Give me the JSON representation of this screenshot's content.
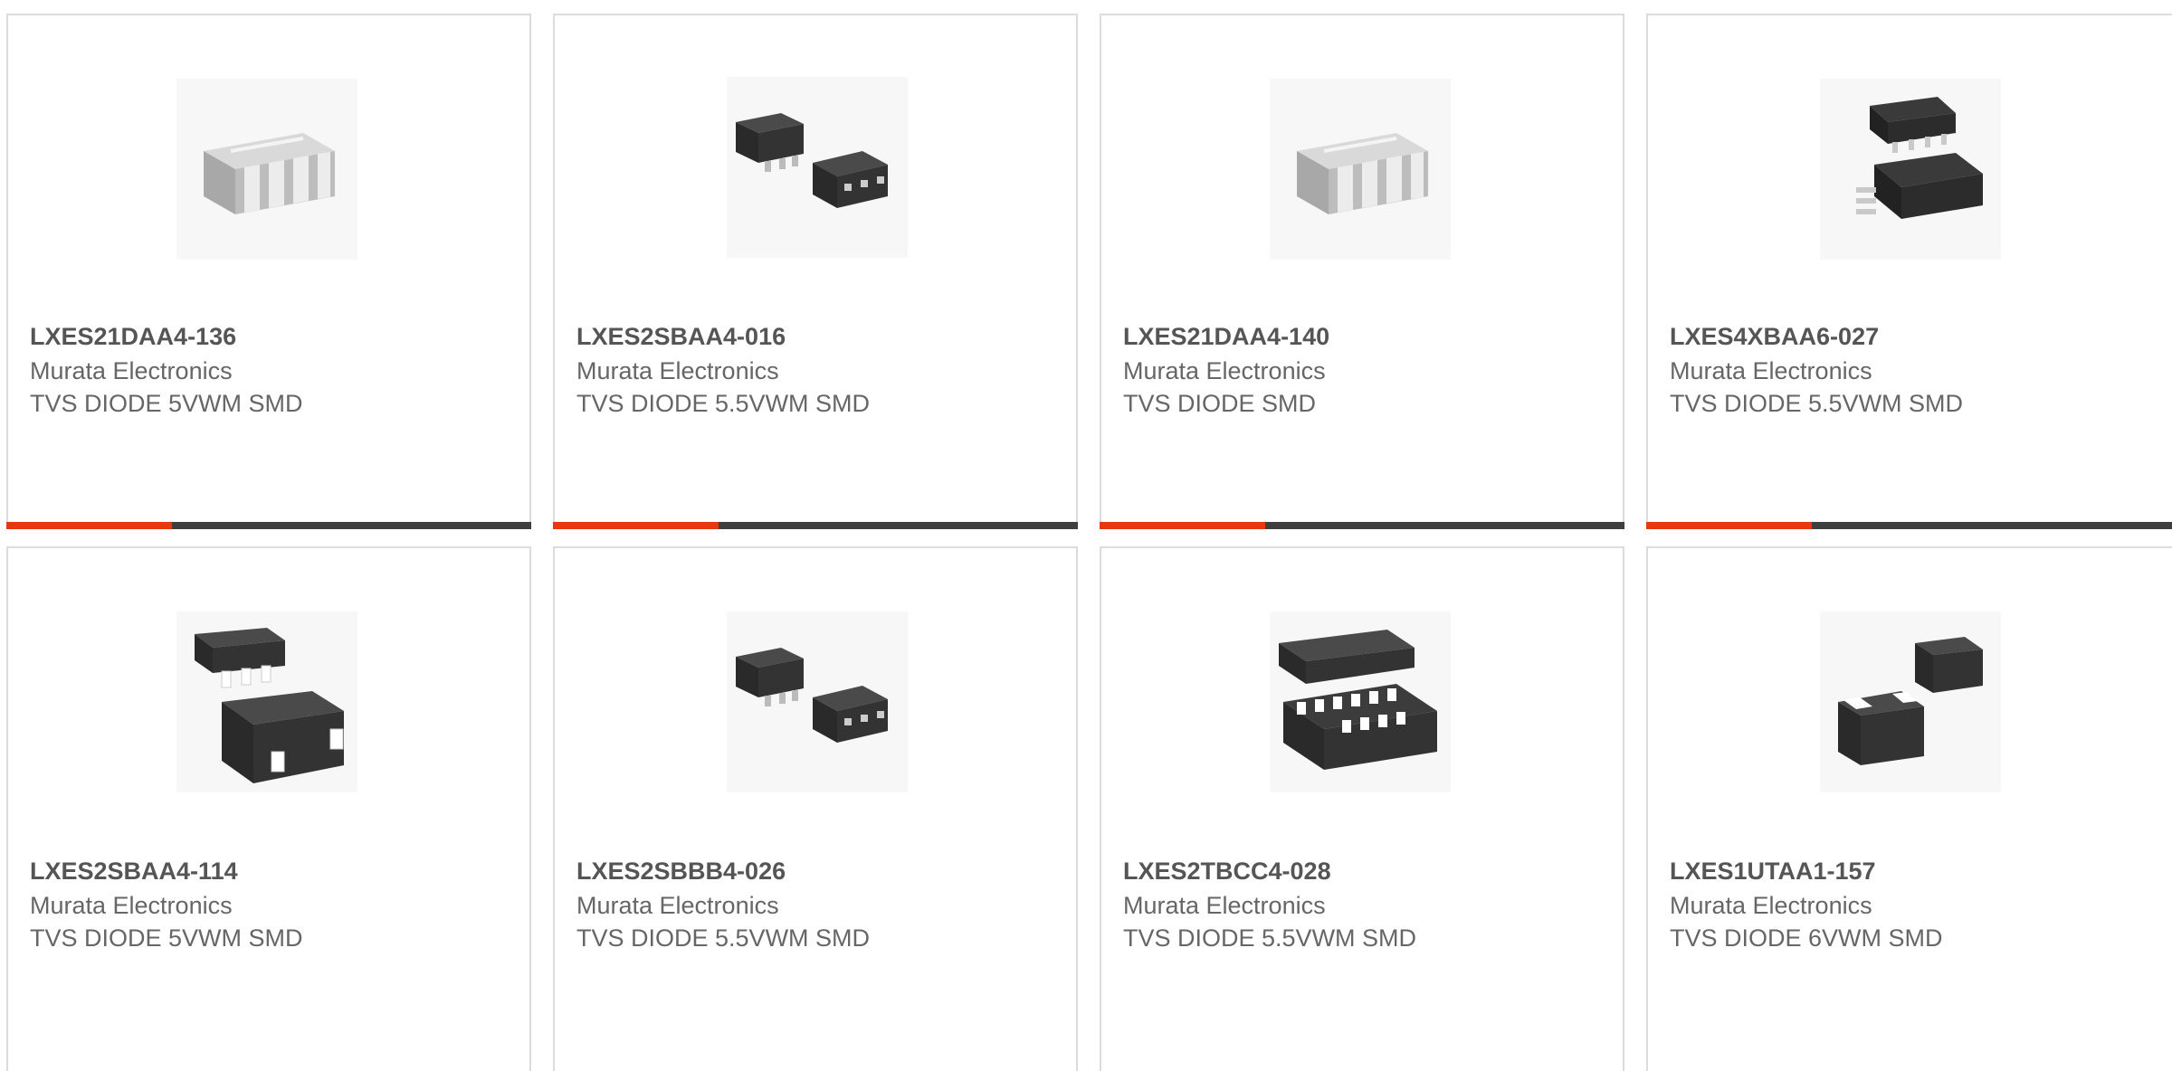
{
  "accent_color": "#e8380d",
  "bar_color": "#3f3f3f",
  "products": [
    {
      "part": "LXES21DAA4-136",
      "manufacturer": "Murata Electronics",
      "description": "TVS DIODE 5VWM SMD",
      "icon": "ceramic-array-chip-icon"
    },
    {
      "part": "LXES2SBAA4-016",
      "manufacturer": "Murata Electronics",
      "description": "TVS DIODE 5.5VWM SMD",
      "icon": "sot-package-icon"
    },
    {
      "part": "LXES21DAA4-140",
      "manufacturer": "Murata Electronics",
      "description": "TVS DIODE SMD",
      "icon": "ceramic-array-chip-icon"
    },
    {
      "part": "LXES4XBAA6-027",
      "manufacturer": "Murata Electronics",
      "description": "TVS DIODE 5.5VWM SMD",
      "icon": "msop-package-icon"
    },
    {
      "part": "LXES2SBAA4-114",
      "manufacturer": "Murata Electronics",
      "description": "TVS DIODE 5VWM SMD",
      "icon": "sot-package-large-icon"
    },
    {
      "part": "LXES2SBBB4-026",
      "manufacturer": "Murata Electronics",
      "description": "TVS DIODE 5.5VWM SMD",
      "icon": "sot-package-icon"
    },
    {
      "part": "LXES2TBCC4-028",
      "manufacturer": "Murata Electronics",
      "description": "TVS DIODE 5.5VWM SMD",
      "icon": "dfn-array-package-icon"
    },
    {
      "part": "LXES1UTAA1-157",
      "manufacturer": "Murata Electronics",
      "description": "TVS DIODE 6VWM SMD",
      "icon": "sod-package-icon"
    }
  ]
}
